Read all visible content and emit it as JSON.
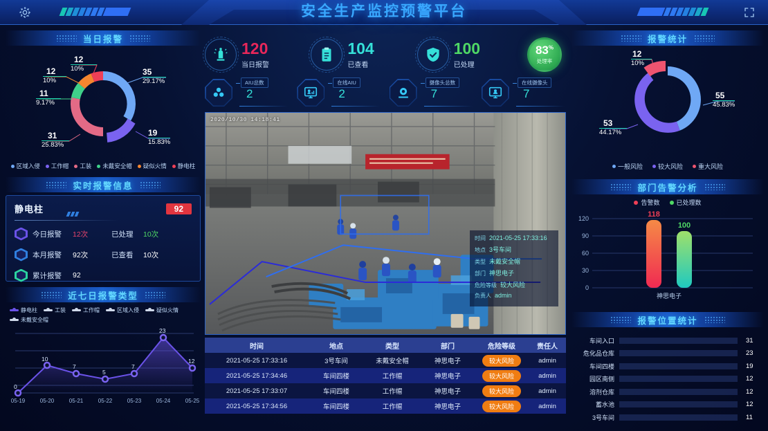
{
  "header": {
    "title": "安全生产监控预警平台",
    "gear_icon": "gear-icon",
    "expand_icon": "expand-icon"
  },
  "panels": {
    "daily_alarm": "当日报警",
    "realtime_info": "实时报警信息",
    "seven_day": "近七日报警类型",
    "alarm_stats": "报警统计",
    "dept_analysis": "部门告警分析",
    "location_stats": "报警位置统计"
  },
  "kpis": [
    {
      "value": "120",
      "label": "当日报警",
      "color": "#e8275a",
      "icon": "alarm-light-icon"
    },
    {
      "value": "104",
      "label": "已查看",
      "color": "#35e0d8",
      "icon": "clipboard-icon"
    },
    {
      "value": "100",
      "label": "已处理",
      "color": "#4fd865",
      "icon": "shield-check-icon"
    }
  ],
  "gauge": {
    "value": "83",
    "unit": "%",
    "label": "处理率",
    "percent": 83,
    "color": "#3cbf63"
  },
  "devices": [
    {
      "label": "AIU总数",
      "value": "2",
      "icon": "cubes-icon"
    },
    {
      "label": "在线AIU",
      "value": "2",
      "icon": "monitor-aiu-icon"
    },
    {
      "label": "摄像头总数",
      "value": "7",
      "icon": "camera-icon"
    },
    {
      "label": "在线摄像头",
      "value": "7",
      "icon": "monitor-camera-icon"
    }
  ],
  "video": {
    "timestamp": "2020/10/30  14:18:41",
    "overlay": {
      "rows": [
        {
          "key": "时间",
          "value": "2021-05-25 17:33:16"
        },
        {
          "key": "地点",
          "value": "3号车间"
        },
        {
          "key": "类型",
          "value": "未戴安全帽"
        },
        {
          "key": "部门",
          "value": "神思电子"
        },
        {
          "key": "危险等级",
          "value": "较大风险"
        },
        {
          "key": "负责人",
          "value": "admin"
        }
      ]
    }
  },
  "table": {
    "columns": [
      "时间",
      "地点",
      "类型",
      "部门",
      "危险等级",
      "责任人"
    ],
    "rows": [
      [
        "2021-05-25 17:33:16",
        "3号车间",
        "未戴安全帽",
        "神思电子",
        "较大风险",
        "admin"
      ],
      [
        "2021-05-25 17:34:46",
        "车间四楼",
        "工作帽",
        "神思电子",
        "较大风险",
        "admin"
      ],
      [
        "2021-05-25 17:33:07",
        "车间四楼",
        "工作帽",
        "神思电子",
        "较大风险",
        "admin"
      ],
      [
        "2021-05-25 17:34:56",
        "车间四楼",
        "工作帽",
        "神思电子",
        "较大风险",
        "admin"
      ]
    ],
    "pill_color": "#f07d12"
  },
  "realtime": {
    "name": "静电柱",
    "badge": "92",
    "rows": [
      {
        "icon": "alarm-hex-icon",
        "label": "今日报警",
        "value": "12次",
        "value_color": "#e8446c",
        "label2": "已处理",
        "value2": "10次",
        "value2_color": "#4fd865"
      },
      {
        "icon": "grid-hex-icon",
        "label": "本月报警",
        "value": "92次",
        "value_color": "#ffffff",
        "label2": "已查看",
        "value2": "10次",
        "value2_color": "#ffffff"
      },
      {
        "icon": "sum-hex-icon",
        "label": "累计报警",
        "value": "92",
        "value_color": "#ffffff",
        "label2": "",
        "value2": "",
        "value2_color": "#ffffff"
      }
    ]
  },
  "chart_data": [
    {
      "type": "pie",
      "title": "当日报警",
      "legend_position": "bottom",
      "labels": [
        "区域入侵",
        "工作帽",
        "工装",
        "未戴安全帽",
        "疑似火情",
        "静电柱"
      ],
      "values": [
        35,
        19,
        31,
        11,
        12,
        12
      ],
      "percents": [
        "29.17%",
        "15.83%",
        "25.83%",
        "9.17%",
        "10%",
        "10%"
      ],
      "colors": [
        "#6fa8f5",
        "#7a63f0",
        "#e36a86",
        "#3fd18a",
        "#f5862f",
        "#ef3f56"
      ]
    },
    {
      "type": "pie",
      "title": "报警统计",
      "legend_position": "bottom",
      "labels": [
        "一般风险",
        "较大风险",
        "重大风险"
      ],
      "values": [
        55,
        53,
        12
      ],
      "percents": [
        "45.83%",
        "44.17%",
        "10%"
      ],
      "colors": [
        "#6fa8f5",
        "#7a63f0",
        "#ef5470"
      ]
    },
    {
      "type": "line",
      "title": "近七日报警类型",
      "categories": [
        "05-19",
        "05-20",
        "05-21",
        "05-22",
        "05-23",
        "05-24",
        "05-25"
      ],
      "series": [
        {
          "name": "静电柱",
          "values": [
            0,
            10,
            7,
            5,
            7,
            23,
            12
          ]
        }
      ],
      "legend": [
        "静电柱",
        "工装",
        "工作帽",
        "区域入侵",
        "疑似火情",
        "未戴安全帽"
      ],
      "ylim": [
        0,
        25
      ],
      "color": "#6a52e8",
      "grid": true
    },
    {
      "type": "bar",
      "title": "部门告警分析",
      "categories": [
        "神思电子"
      ],
      "series": [
        {
          "name": "告警数",
          "values": [
            118
          ],
          "color": "#ef3f56"
        },
        {
          "name": "已处理数",
          "values": [
            100
          ],
          "color": "#4fd865"
        }
      ],
      "yticks": [
        0,
        30,
        60,
        90,
        120
      ],
      "ylim": [
        0,
        120
      ],
      "grid": true
    },
    {
      "type": "bar",
      "title": "报警位置统计",
      "orientation": "horizontal",
      "categories": [
        "车间入口",
        "危化品仓库",
        "车间四楼",
        "园区南侧",
        "溶剂仓库",
        "蓄水池",
        "3号车间"
      ],
      "values": [
        31,
        23,
        19,
        12,
        12,
        12,
        11
      ],
      "max": 35
    }
  ]
}
